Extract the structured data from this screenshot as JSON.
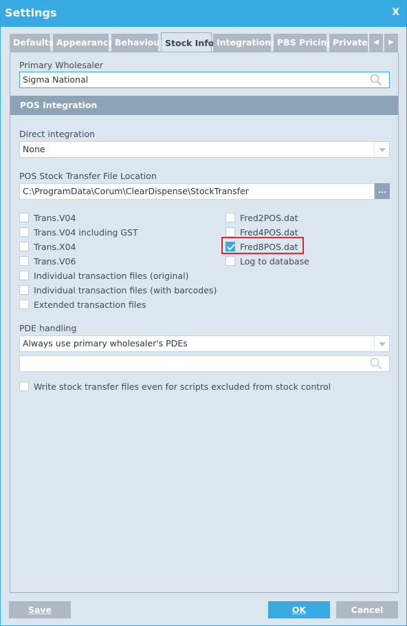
{
  "window": {
    "title": "Settings",
    "close_label": "X"
  },
  "tabs": [
    {
      "label": "Defaults"
    },
    {
      "label": "Appearance"
    },
    {
      "label": "Behaviour"
    },
    {
      "label": "Stock Info",
      "active": true
    },
    {
      "label": "Integrations"
    },
    {
      "label": "PBS Pricing"
    },
    {
      "label": "Private P"
    }
  ],
  "tab_scroll": {
    "left": "◀",
    "right": "▶"
  },
  "primary_wholesaler": {
    "label": "Primary Wholesaler",
    "value": "Sigma National"
  },
  "pos_integration": {
    "header": "POS Integration",
    "direct_integration": {
      "label": "Direct integration",
      "value": "None"
    },
    "file_location": {
      "label": "POS Stock Transfer File Location",
      "value": "C:\\ProgramData\\Corum\\ClearDispense\\StockTransfer",
      "browse_label": "..."
    },
    "left_options": [
      {
        "label": "Trans.V04",
        "checked": false
      },
      {
        "label": "Trans.V04 including GST",
        "checked": false
      },
      {
        "label": "Trans.X04",
        "checked": false
      },
      {
        "label": "Trans.V06",
        "checked": false
      },
      {
        "label": "Individual transaction files (original)",
        "checked": false
      },
      {
        "label": "Individual transaction files (with barcodes)",
        "checked": false
      },
      {
        "label": "Extended transaction files",
        "checked": false
      }
    ],
    "right_options": [
      {
        "label": "Fred2POS.dat",
        "checked": false
      },
      {
        "label": "Fred4POS.dat",
        "checked": false
      },
      {
        "label": "Fred8POS.dat",
        "checked": true
      },
      {
        "label": "Log to database",
        "checked": false
      }
    ],
    "pde_handling": {
      "label": "PDE handling",
      "value": "Always use primary wholesaler's PDEs",
      "search_value": ""
    },
    "write_stock_transfer": {
      "label": "Write stock transfer files even for scripts excluded from stock control",
      "checked": false
    }
  },
  "footer": {
    "save_label": "Save",
    "ok_label": "OK",
    "cancel_label": "Cancel"
  },
  "colors": {
    "accent": "#39a9e1",
    "section_header": "#8da3b8",
    "disabled_button": "#aeb9c4",
    "highlight": "#e0262b"
  },
  "icons": {
    "search": "search-icon",
    "dropdown": "chevron-down-icon",
    "check": "check-icon"
  }
}
